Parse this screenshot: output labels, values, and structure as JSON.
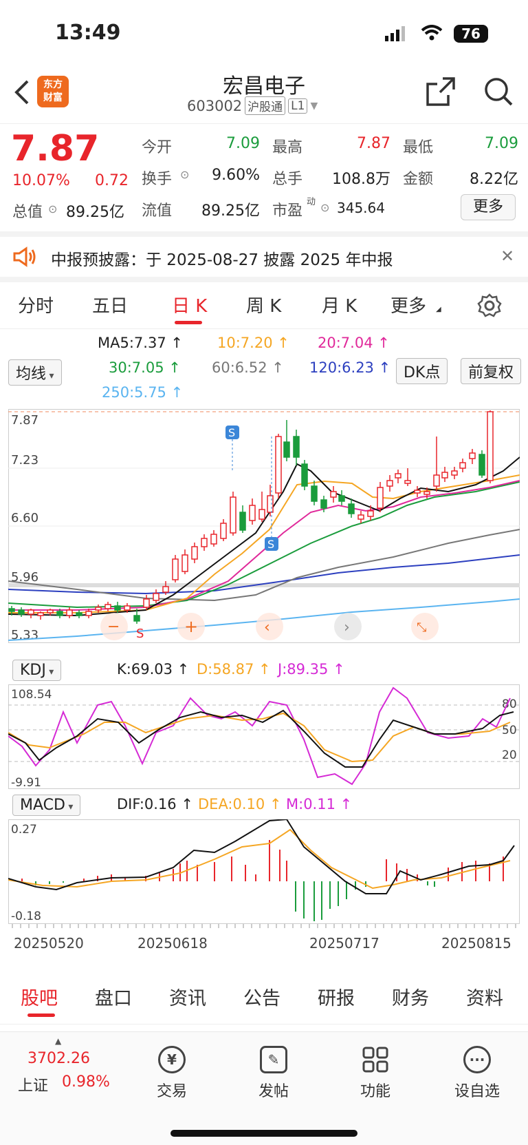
{
  "status": {
    "time": "13:49",
    "battery": "76"
  },
  "nav": {
    "title": "宏昌电子",
    "code": "603002",
    "badge1": "沪股通",
    "badge2": "L1",
    "logo_line1": "东方",
    "logo_line2": "财富"
  },
  "quote": {
    "price": "7.87",
    "pct": "10.07%",
    "chg": "0.72",
    "open_label": "今开",
    "open": "7.09",
    "high_label": "最高",
    "high": "7.87",
    "low_label": "最低",
    "low": "7.09",
    "turnover_label": "换手",
    "turnover": "9.60%",
    "volume_label": "总手",
    "volume": "108.8万",
    "amount_label": "金额",
    "amount": "8.22亿",
    "mktcap_label": "总值",
    "mktcap": "89.25亿",
    "float_label": "流值",
    "float": "89.25亿",
    "pe_label": "市盈",
    "pe_sup": "动",
    "pe": "345.64",
    "more": "更多"
  },
  "banner": {
    "text": "中报预披露：于 2025-08-27 披露 2025 年中报"
  },
  "tabs": [
    "分时",
    "五日",
    "日 K",
    "周 K",
    "月 K",
    "更多"
  ],
  "ma": {
    "selector": "均线",
    "ma5": "MA5:7.37",
    "ma10": "10:7.20",
    "ma20": "20:7.04",
    "ma30": "30:7.05",
    "ma60": "60:6.52",
    "ma120": "120:6.23",
    "ma250": "250:5.75",
    "dk": "DK点",
    "fq": "前复权",
    "colors": {
      "ma5": "#111111",
      "ma10": "#f5a623",
      "ma20": "#e0299a",
      "ma30": "#1a9c3c",
      "ma60": "#777777",
      "ma120": "#2c3fbf",
      "ma250": "#5ab4f0"
    }
  },
  "kline": {
    "y_labels": [
      "7.87",
      "7.23",
      "6.60",
      "5.96",
      "5.33"
    ],
    "markers": [
      "S",
      "S",
      "S"
    ]
  },
  "kdj": {
    "selector": "KDJ",
    "k": "K:69.03",
    "d": "D:58.87",
    "j": "J:89.35",
    "ymax": "108.54",
    "ymin": "-9.91",
    "l80": "80",
    "l50": "50",
    "l20": "20"
  },
  "macd": {
    "selector": "MACD",
    "dif": "DIF:0.16",
    "dea": "DEA:0.10",
    "m": "M:0.11",
    "ymax": "0.27",
    "ymin": "-0.18"
  },
  "dates": [
    "20250520",
    "20250618",
    "20250717",
    "20250815"
  ],
  "bottom_tabs": [
    "股吧",
    "盘口",
    "资讯",
    "公告",
    "研报",
    "财务",
    "资料"
  ],
  "toolbar": {
    "index_value": "3702.26",
    "index_name": "上证",
    "index_pct": "0.98%",
    "items": [
      "交易",
      "发帖",
      "功能",
      "设自选"
    ]
  }
}
